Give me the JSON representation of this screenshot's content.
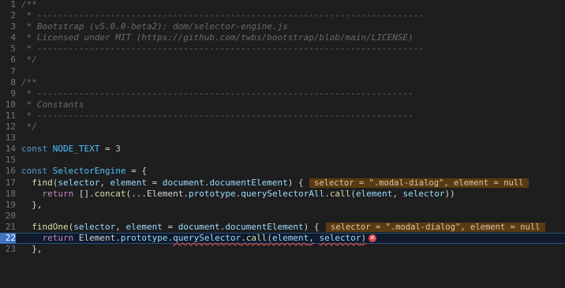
{
  "editor": {
    "current_line": 22,
    "lines": [
      {
        "n": "1",
        "code": "/**"
      },
      {
        "n": "2",
        "code": " * --------------------------------------------------------------------------"
      },
      {
        "n": "3",
        "code": " * Bootstrap (v5.0.0-beta2): dom/selector-engine.js"
      },
      {
        "n": "4",
        "code": " * Licensed under MIT (https://github.com/twbs/bootstrap/blob/main/LICENSE)"
      },
      {
        "n": "5",
        "code": " * --------------------------------------------------------------------------"
      },
      {
        "n": "6",
        "code": " */"
      },
      {
        "n": "7",
        "code": ""
      },
      {
        "n": "8",
        "code": "/**"
      },
      {
        "n": "9",
        "code": " * ------------------------------------------------------------------------"
      },
      {
        "n": "10",
        "code": " * Constants"
      },
      {
        "n": "11",
        "code": " * ------------------------------------------------------------------------"
      },
      {
        "n": "12",
        "code": " */"
      },
      {
        "n": "13",
        "code": ""
      },
      {
        "n": "14",
        "code": "const NODE_TEXT = 3"
      },
      {
        "n": "15",
        "code": ""
      },
      {
        "n": "16",
        "code": "const SelectorEngine = {"
      },
      {
        "n": "17",
        "code": "  find(selector, element = document.documentElement) {"
      },
      {
        "n": "18",
        "code": "    return [].concat(...Element.prototype.querySelectorAll.call(element, selector))"
      },
      {
        "n": "19",
        "code": "  },"
      },
      {
        "n": "20",
        "code": ""
      },
      {
        "n": "21",
        "code": "  findOne(selector, element = document.documentElement) {"
      },
      {
        "n": "22",
        "code": "    return Element.prototype.querySelector.call(element, selector)"
      },
      {
        "n": "23",
        "code": "  },"
      }
    ],
    "inlay_hints": {
      "line17": "selector = \".modal-dialog\", element = null",
      "line21": "selector = \".modal-dialog\", element = null"
    },
    "error_icon": "error-circle-icon",
    "colors": {
      "background": "#1e1e1e",
      "keyword": "#569cd6",
      "function": "#dcdcaa",
      "variable": "#9cdcfe",
      "number": "#b5cea8",
      "comment": "#6b6b6b",
      "inlay_bg": "#5a3a12",
      "error": "#e0474d",
      "current_line_gutter": "#3f74c2"
    }
  }
}
